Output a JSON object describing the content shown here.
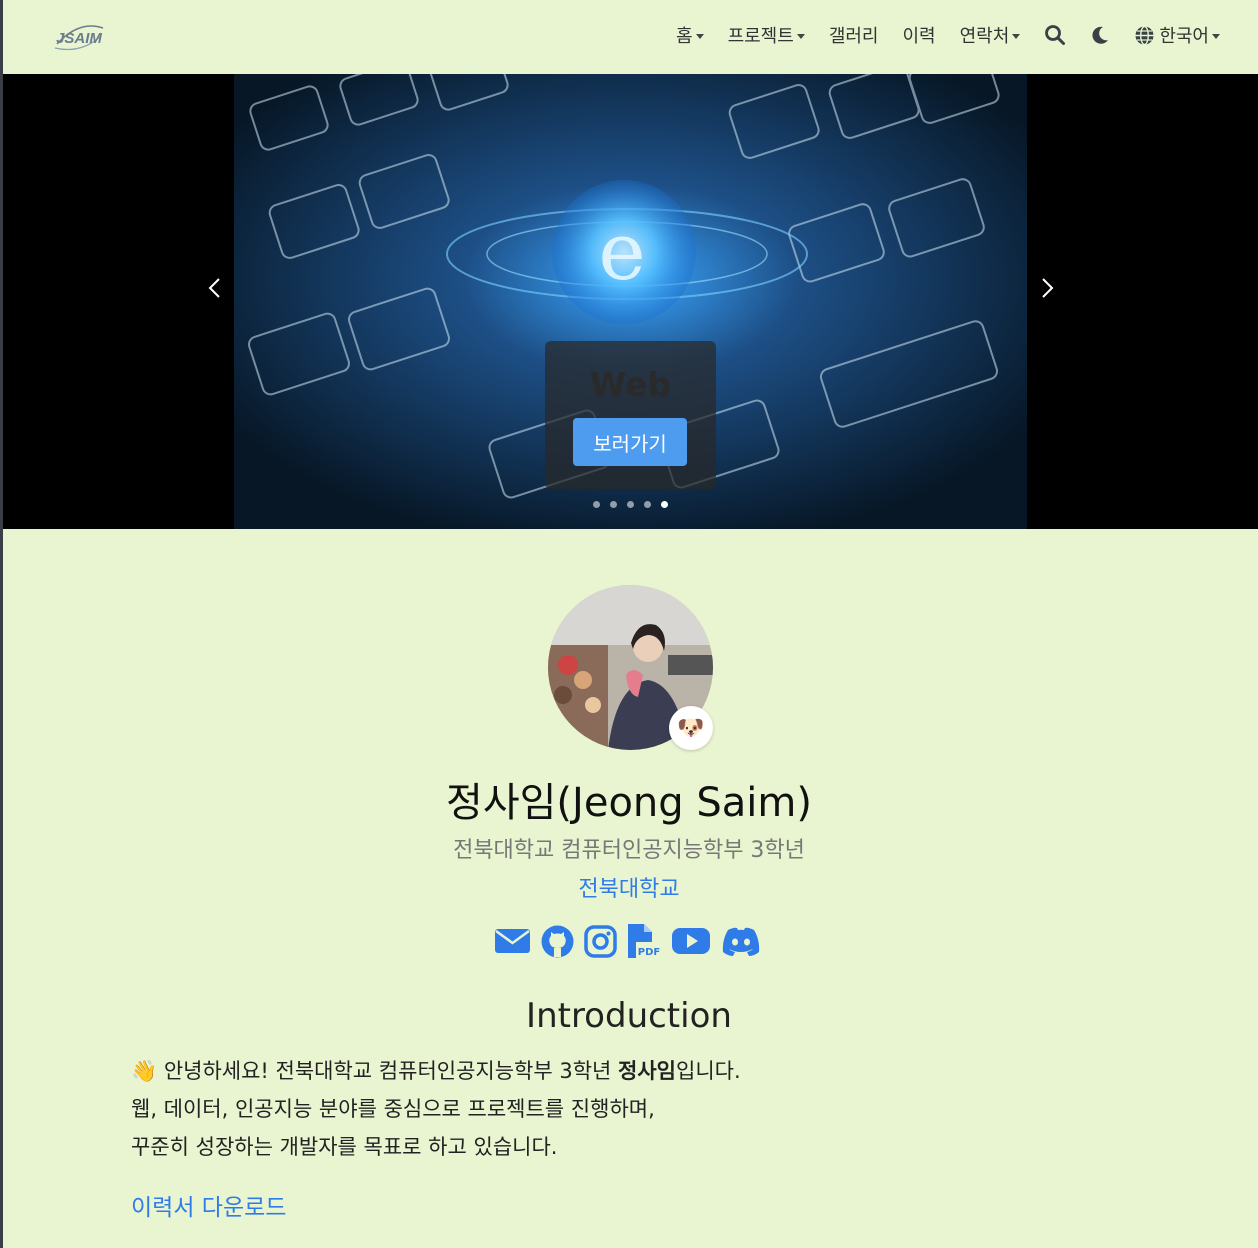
{
  "navbar": {
    "logo_text": "JSAIM",
    "items": [
      {
        "label": "홈",
        "dropdown": true
      },
      {
        "label": "프로젝트",
        "dropdown": true
      },
      {
        "label": "갤러리",
        "dropdown": false
      },
      {
        "label": "이력",
        "dropdown": false
      },
      {
        "label": "연락처",
        "dropdown": true
      }
    ],
    "language": "한국어",
    "icons": [
      "search-icon",
      "moon-icon",
      "globe-icon"
    ]
  },
  "carousel": {
    "caption_title": "Web",
    "caption_button": "보러가기",
    "slide_count": 5,
    "active_index": 4
  },
  "profile": {
    "name": "정사임(Jeong Saim)",
    "subtitle": "전북대학교 컴퓨터인공지능학부 3학년",
    "school": "전북대학교",
    "badge_emoji": "🐶",
    "social_icons": [
      "email-icon",
      "github-icon",
      "instagram-icon",
      "pdf-icon",
      "youtube-icon",
      "discord-icon"
    ]
  },
  "intro": {
    "title": "Introduction",
    "wave_emoji": "👋",
    "line1_pre": " 안녕하세요! 전북대학교 컴퓨터인공지능학부 3학년 ",
    "line1_bold": "정사임",
    "line1_post": "입니다.",
    "line2": "웹, 데이터, 인공지능 분야를 중심으로 프로젝트를 진행하며,",
    "line3": "꾸준히 성장하는 개발자를 목표로 하고 있습니다."
  },
  "download_label": "이력서 다운로드",
  "colors": {
    "background": "#e8f5d0",
    "link": "#2f7ce8",
    "button": "#4d9cf0"
  }
}
